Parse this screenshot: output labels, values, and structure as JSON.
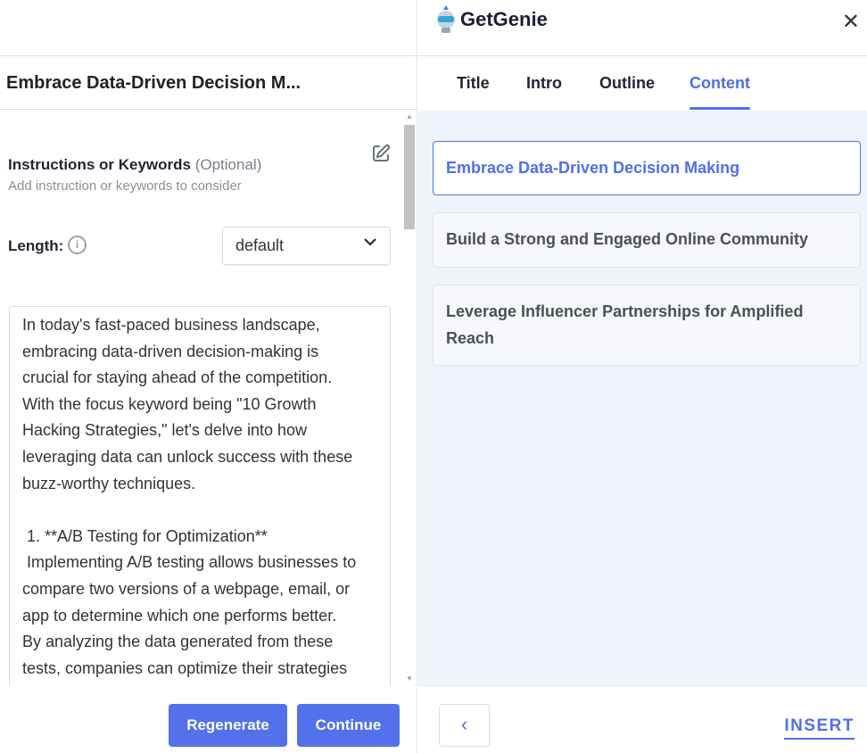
{
  "left_panel": {
    "title": "Embrace Data-Driven Decision M...",
    "instructions_label": "Instructions or Keywords",
    "instructions_optional": "(Optional)",
    "instructions_hint": "Add instruction or keywords to consider",
    "length_label": "Length:",
    "length_value": "default",
    "content_text": "In today's fast-paced business landscape,\nembracing data-driven decision-making is\ncrucial for staying ahead of the competition.\nWith the focus keyword being \"10 Growth\nHacking Strategies,\" let's delve into how\nleveraging data can unlock success with these\nbuzz-worthy techniques.\n\n 1. **A/B Testing for Optimization**\n Implementing A/B testing allows businesses to\ncompare two versions of a webpage, email, or\napp to determine which one performs better.\nBy analyzing the data generated from these\ntests, companies can optimize their strategies",
    "regenerate_label": "Regenerate",
    "continue_label": "Continue"
  },
  "right_panel": {
    "brand": "GetGenie",
    "tabs": [
      {
        "label": "Title",
        "active": false
      },
      {
        "label": "Intro",
        "active": false
      },
      {
        "label": "Outline",
        "active": false
      },
      {
        "label": "Content",
        "active": true
      }
    ],
    "outline_items": [
      {
        "label": "Embrace Data-Driven Decision Making",
        "selected": true
      },
      {
        "label": "Build a Strong and Engaged Online Community",
        "selected": false
      },
      {
        "label": "Leverage Influencer Partnerships for Amplified Reach",
        "selected": false
      }
    ],
    "insert_label": "INSERT"
  },
  "colors": {
    "accent": "#5271ea",
    "panel_bg": "#eff3fa"
  }
}
